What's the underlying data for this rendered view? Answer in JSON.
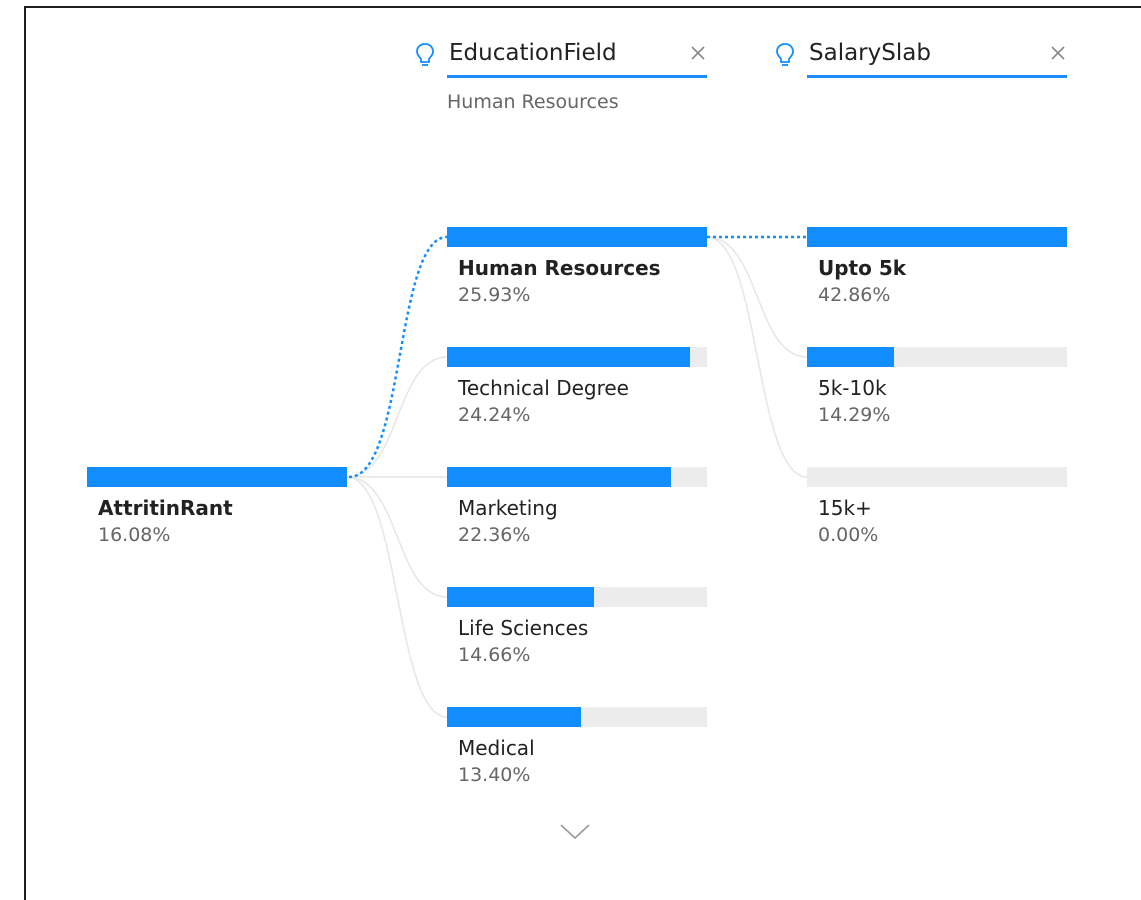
{
  "root": {
    "label": "AttritinRant",
    "value": "16.08%",
    "fill": 1.0
  },
  "columns": [
    {
      "id": "education",
      "title": "EducationField",
      "subtitle": "Human Resources",
      "items": [
        {
          "label": "Human Resources",
          "value": "25.93%",
          "fill": 1.0,
          "selected": true
        },
        {
          "label": "Technical Degree",
          "value": "24.24%",
          "fill": 0.935
        },
        {
          "label": "Marketing",
          "value": "22.36%",
          "fill": 0.862
        },
        {
          "label": "Life Sciences",
          "value": "14.66%",
          "fill": 0.565
        },
        {
          "label": "Medical",
          "value": "13.40%",
          "fill": 0.517
        }
      ]
    },
    {
      "id": "salary",
      "title": "SalarySlab",
      "subtitle": "",
      "items": [
        {
          "label": "Upto 5k",
          "value": "42.86%",
          "fill": 1.0,
          "selected": true
        },
        {
          "label": "5k-10k",
          "value": "14.29%",
          "fill": 0.333
        },
        {
          "label": "15k+",
          "value": "0.00%",
          "fill": 0.0
        }
      ]
    }
  ],
  "icons": {
    "header": "lightbulb-icon",
    "close": "close-icon",
    "expand": "chevron-down-icon"
  },
  "colors": {
    "accent": "#118dff",
    "track": "#ececec",
    "connector": "#e6e6e6",
    "text": "#222222",
    "subtext": "#666666"
  }
}
